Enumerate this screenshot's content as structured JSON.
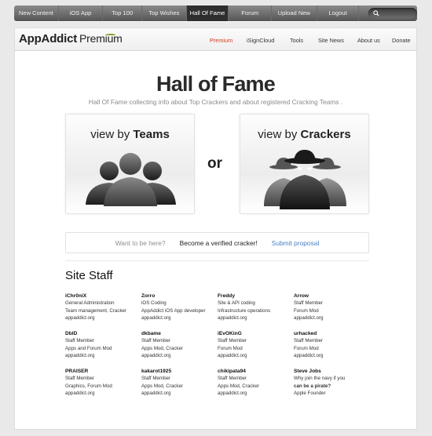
{
  "topnav": {
    "items": [
      {
        "label": "New Content",
        "width": 57,
        "active": false
      },
      {
        "label": "iOS App",
        "width": 57,
        "active": false
      },
      {
        "label": "Top 100",
        "width": 50,
        "active": false
      },
      {
        "label": "Top Wishes",
        "width": 57,
        "active": false
      },
      {
        "label": "Hall Of Fame",
        "width": 54,
        "active": true
      },
      {
        "label": "Forum",
        "width": 55,
        "active": false
      },
      {
        "label": "Upload New",
        "width": 58,
        "active": false
      },
      {
        "label": "Logout",
        "width": 54,
        "active": false
      }
    ]
  },
  "header": {
    "logo_main": "AppAddict",
    "logo_sub": "Premium",
    "subnav": [
      {
        "label": "Premium",
        "active": true
      },
      {
        "label": "iSignCloud",
        "active": false
      },
      {
        "label": "Tools",
        "active": false
      },
      {
        "label": "Site News",
        "active": false
      },
      {
        "label": "About us",
        "active": false
      },
      {
        "label": "Donate",
        "active": false
      }
    ]
  },
  "main": {
    "title": "Hall of Fame",
    "subtitle": "Hall Of Fame collecting info about Top Crackers and about registered Cracking Teams .",
    "card_teams": {
      "prefix": "view by ",
      "bold": "Teams"
    },
    "card_crackers": {
      "prefix": "view by ",
      "bold": "Crackers"
    },
    "or_label": "or",
    "cta": {
      "muted": "Want to be here?",
      "main": "Become a verified cracker!",
      "link": "Submit proposal"
    }
  },
  "staff": {
    "heading": "Site Staff",
    "members": [
      {
        "name": "iChr0niX",
        "lines": [
          "General Administration",
          "Team management, Cracker",
          "appaddict.org"
        ]
      },
      {
        "name": "Zorro",
        "lines": [
          "iOS Coding",
          "AppAddict iOS App developer",
          "appaddict.org"
        ]
      },
      {
        "name": "Freddy",
        "lines": [
          "Site & API coding",
          "Infrastructure operations",
          "appaddict.org"
        ]
      },
      {
        "name": "Arrow",
        "lines": [
          "Staff Member",
          "Forum Mod",
          "appaddict.org"
        ]
      },
      {
        "name": "DbID",
        "lines": [
          "Staff Member",
          "Apps and Forum Mod",
          "appaddict.org"
        ]
      },
      {
        "name": "dkbame",
        "lines": [
          "Staff Member",
          "Apps Mod, Cracker",
          "appaddict.org"
        ]
      },
      {
        "name": "iEvOKinG",
        "lines": [
          "Staff Member",
          "Forum Mod",
          "appaddict.org"
        ]
      },
      {
        "name": "urhacked",
        "lines": [
          "Staff Member",
          "Forum Mod",
          "appaddict.org"
        ]
      },
      {
        "name": "PRAISER",
        "lines": [
          "Staff Member",
          "Graphics, Forum Mod",
          "appaddict.org"
        ]
      },
      {
        "name": "kakarot1925",
        "lines": [
          "Staff Member",
          "Apps Mod, Cracker",
          "appaddict.org"
        ]
      },
      {
        "name": "chikipata94",
        "lines": [
          "Staff Member",
          "Apps Mod, Cracker",
          "appaddict.org"
        ]
      },
      {
        "name": "Steve Jobs",
        "lines": [
          "Why join the navy if you",
          "can be a pirate?",
          "Apple Founder"
        ],
        "bold_line": 1
      }
    ]
  }
}
